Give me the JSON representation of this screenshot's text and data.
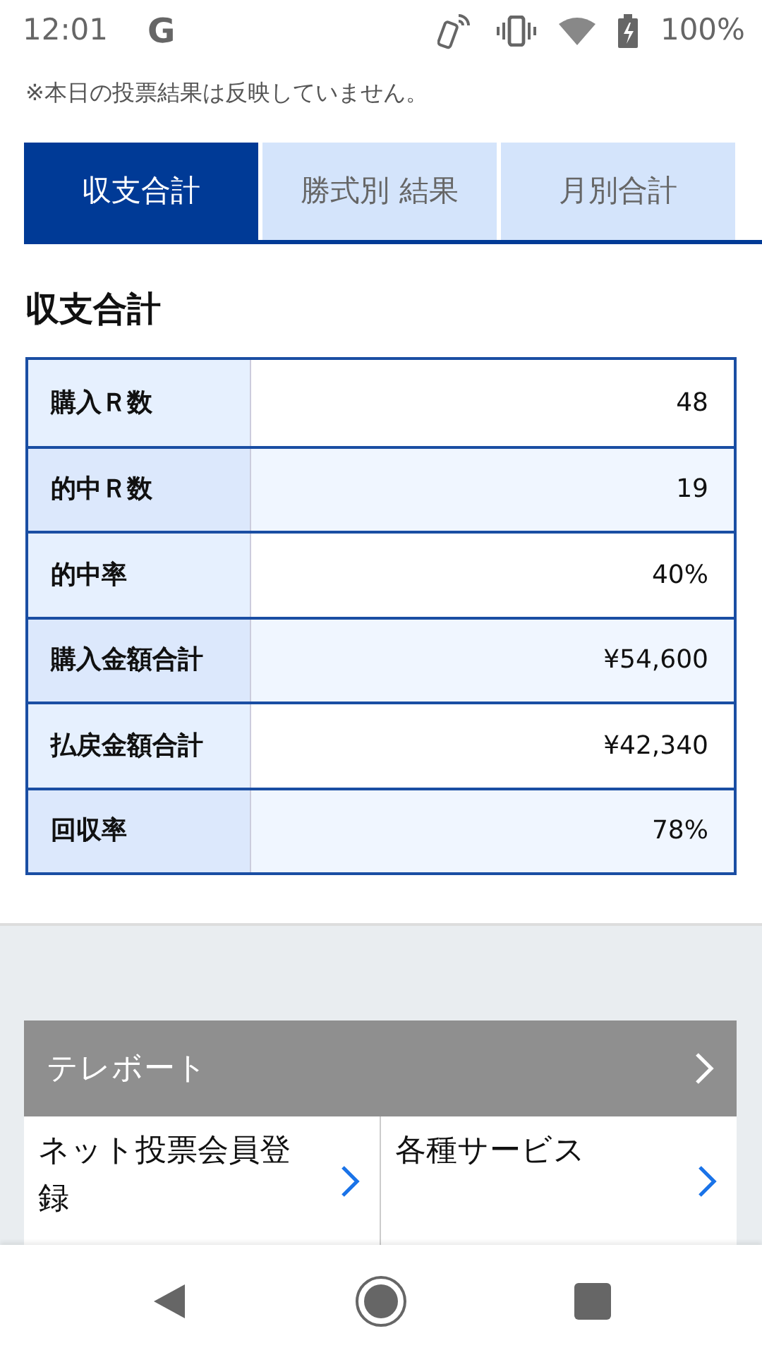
{
  "status_bar": {
    "time": "12:01",
    "app": "G",
    "battery": "100%"
  },
  "notice": "※本日の投票結果は反映していません。",
  "tabs": [
    {
      "label": "収支合計",
      "selected": true
    },
    {
      "label": "勝式別 結果",
      "selected": false
    },
    {
      "label": "月別合計",
      "selected": false
    }
  ],
  "section_title": "収支合計",
  "summary_rows": [
    {
      "label": "購入Ｒ数",
      "value": "48"
    },
    {
      "label": "的中Ｒ数",
      "value": "19"
    },
    {
      "label": "的中率",
      "value": "40%"
    },
    {
      "label": "購入金額合計",
      "value": "¥54,600"
    },
    {
      "label": "払戻金額合計",
      "value": "¥42,340"
    },
    {
      "label": "回収率",
      "value": "78%"
    }
  ],
  "teleport": {
    "title": "テレボート"
  },
  "links": [
    {
      "label": "ネット投票会員登録"
    },
    {
      "label": "各種サービス"
    }
  ]
}
